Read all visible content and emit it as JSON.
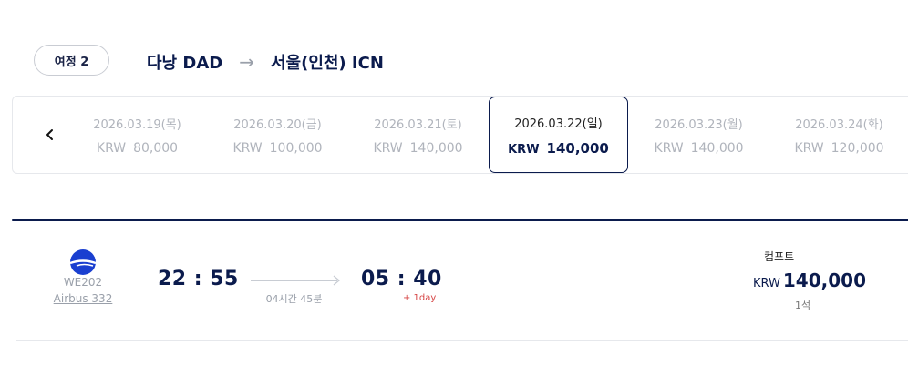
{
  "header": {
    "leg_label": "여정 2",
    "origin": "다낭 DAD",
    "arrow": "→",
    "destination": "서울(인천) ICN"
  },
  "date_strip": {
    "prev_icon": "chevron-left-icon",
    "dates": [
      {
        "date": "2026.03.19(목)",
        "currency": "KRW",
        "price": "80,000",
        "selected": false
      },
      {
        "date": "2026.03.20(금)",
        "currency": "KRW",
        "price": "100,000",
        "selected": false
      },
      {
        "date": "2026.03.21(토)",
        "currency": "KRW",
        "price": "140,000",
        "selected": false
      },
      {
        "date": "2026.03.22(일)",
        "currency": "KRW",
        "price": "140,000",
        "selected": true
      },
      {
        "date": "2026.03.23(월)",
        "currency": "KRW",
        "price": "140,000",
        "selected": false
      },
      {
        "date": "2026.03.24(화)",
        "currency": "KRW",
        "price": "120,000",
        "selected": false
      }
    ]
  },
  "flight": {
    "logo_icon": "airline-logo-icon",
    "flight_no": "WE202",
    "aircraft": "Airbus 332",
    "departure_time": "22 : 55",
    "arrival_time": "05 : 40",
    "duration": "04시간 45분",
    "plus_day": "+ 1day",
    "fare": {
      "class": "컴포트",
      "currency": "KRW",
      "amount": "140,000",
      "seats": "1석"
    }
  },
  "colors": {
    "navy": "#0b1b4d",
    "brand_blue": "#1a3fd0",
    "muted": "#b0b4bc",
    "alert": "#d64545"
  }
}
